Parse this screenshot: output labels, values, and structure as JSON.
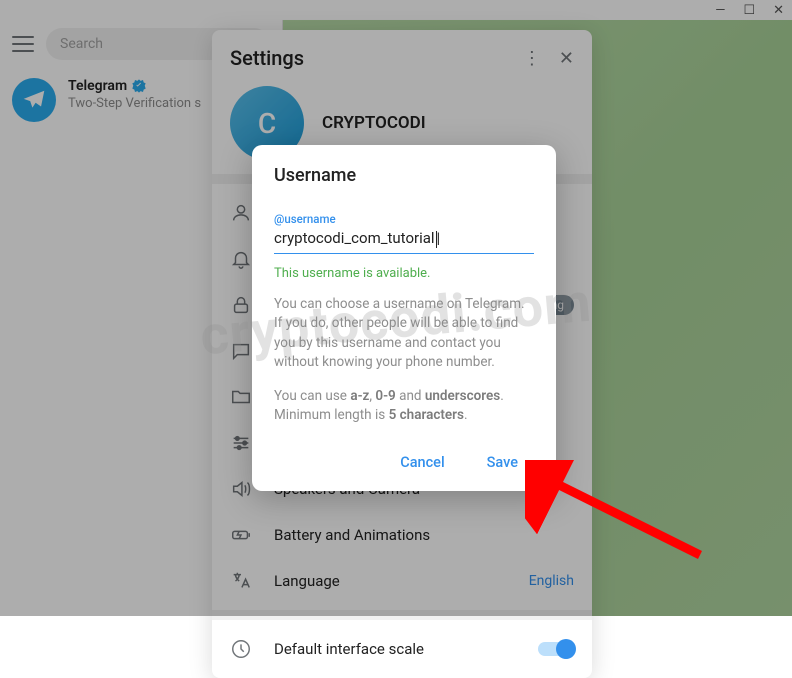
{
  "window": {
    "min": "—",
    "max": "☐",
    "close": "✕"
  },
  "left": {
    "search_placeholder": "Search",
    "chat": {
      "title": "Telegram",
      "subtitle": "Two-Step Verification s"
    }
  },
  "settings": {
    "title": "Settings",
    "profile_name": "CRYPTOCODI",
    "profile_initial": "C",
    "items": {
      "my_account": "My Account",
      "notifications": "Notifications",
      "privacy": "Privacy and Security",
      "chat": "Chat Settings",
      "folders": "Folders",
      "advanced": "Advanced",
      "speakers": "Speakers and Camera",
      "battery": "Battery and Animations",
      "language": "Language",
      "language_value": "English",
      "interface_scale": "Default interface scale",
      "badge": "ssaging"
    }
  },
  "dialog": {
    "title": "Username",
    "field_label": "@username",
    "field_value": "cryptocodi_com_tutorial",
    "status": "This username is available.",
    "help1_a": "You can choose a username on Telegram. If you do, other people will be able to find you by this username and contact you without knowing your phone number.",
    "help2_a": "You can use ",
    "help2_b": "a-z",
    "help2_c": ", ",
    "help2_d": "0-9",
    "help2_e": " and ",
    "help2_f": "underscores",
    "help2_g": ". Minimum length is ",
    "help2_h": "5 characters",
    "help2_i": ".",
    "cancel": "Cancel",
    "save": "Save"
  },
  "watermark": "cryptocodi.com"
}
